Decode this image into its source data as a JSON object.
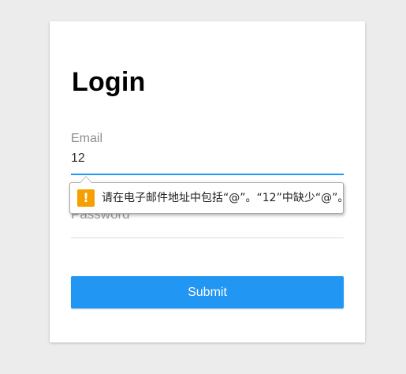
{
  "page": {
    "title": "Login"
  },
  "form": {
    "email": {
      "label": "Email",
      "value": "12"
    },
    "password": {
      "label": "Password",
      "value": ""
    },
    "submit_label": "Submit"
  },
  "validation_tooltip": {
    "icon": "warning-icon",
    "message": "请在电子邮件地址中包括“@”。“12”中缺少“@”。"
  },
  "colors": {
    "accent": "#2196f3",
    "warning": "#f5a000",
    "background": "#ececec"
  }
}
